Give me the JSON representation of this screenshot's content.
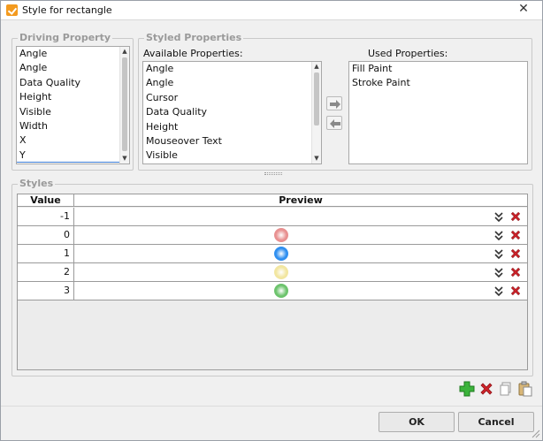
{
  "window": {
    "title": "Style for rectangle",
    "close_glyph": "✕"
  },
  "driving_property": {
    "legend": "Driving Property",
    "items": [
      "Angle",
      "Angle",
      "Data Quality",
      "Height",
      "Visible",
      "Width",
      "X",
      "Y"
    ]
  },
  "styled_properties": {
    "legend": "Styled Properties",
    "available_label": "Available Properties:",
    "available_items": [
      "Angle",
      "Angle",
      "Cursor",
      "Data Quality",
      "Height",
      "Mouseover Text",
      "Visible"
    ],
    "used_label": "Used Properties:",
    "used_items": [
      "Fill Paint",
      "Stroke Paint"
    ]
  },
  "styles": {
    "legend": "Styles",
    "columns": {
      "value": "Value",
      "preview": "Preview"
    },
    "rows": [
      {
        "value": "-1",
        "color": ""
      },
      {
        "value": "0",
        "color": "#e89090"
      },
      {
        "value": "1",
        "color": "#2f8ff0"
      },
      {
        "value": "2",
        "color": "#f2e6a0"
      },
      {
        "value": "3",
        "color": "#6cc36c"
      }
    ]
  },
  "icons": {
    "move_right": "arrow-right-icon",
    "move_left": "arrow-left-icon",
    "add": "add-icon",
    "delete": "delete-icon",
    "copy": "copy-icon",
    "paste": "paste-icon",
    "expand": "double-chevron-down-icon"
  },
  "buttons": {
    "ok": "OK",
    "cancel": "Cancel"
  }
}
